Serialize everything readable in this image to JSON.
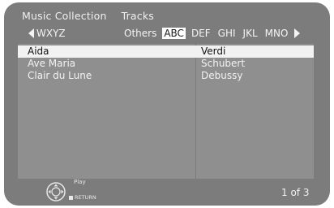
{
  "header": {
    "title": "Music Collection",
    "section": "Tracks"
  },
  "tabs": {
    "prev_label": "WXYZ",
    "items": [
      {
        "label": "Others",
        "active": false
      },
      {
        "label": "ABC",
        "active": true
      },
      {
        "label": "DEF",
        "active": false
      },
      {
        "label": "GHI",
        "active": false
      },
      {
        "label": "JKL",
        "active": false
      },
      {
        "label": "MNO",
        "active": false
      }
    ]
  },
  "tracks": [
    {
      "title": "Aida",
      "artist": "Verdi",
      "selected": true
    },
    {
      "title": "Ave Maria",
      "artist": "Schubert",
      "selected": false
    },
    {
      "title": "Clair du Lune",
      "artist": "Debussy",
      "selected": false
    }
  ],
  "footer": {
    "play_label": "Play",
    "return_label": "RETURN",
    "page_indicator": "1 of 3"
  },
  "icons": {
    "dpad": "dpad-enter-icon",
    "prev": "left-triangle-icon",
    "next": "right-triangle-icon",
    "return": "stop-square-icon"
  }
}
